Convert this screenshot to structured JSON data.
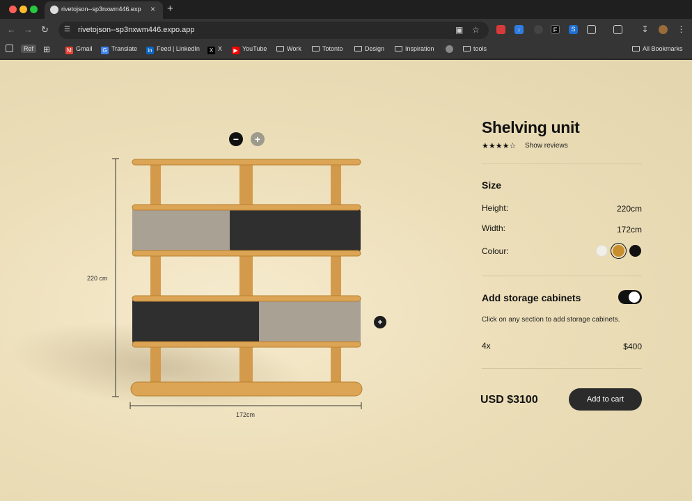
{
  "browser": {
    "tab_title": "rivetojson--sp3nxwm446.exp",
    "tab_close": "×",
    "new_tab": "+",
    "url": "rivetojson--sp3nxwm446.expo.app",
    "icons": [
      "back-icon",
      "forward-icon",
      "reload-icon",
      "site-info-icon",
      "translate-icon",
      "star-icon",
      "extensions-icon",
      "download-icon",
      "profile-icon",
      "menu-icon"
    ]
  },
  "bookmarks": [
    {
      "label": "Ref",
      "kind": "badge"
    },
    {
      "label": "Gmail",
      "kind": "gmail"
    },
    {
      "label": "Translate",
      "kind": "translate"
    },
    {
      "label": "Feed | LinkedIn",
      "kind": "linkedin"
    },
    {
      "label": "X",
      "kind": "x"
    },
    {
      "label": "YouTube",
      "kind": "youtube"
    },
    {
      "label": "Work",
      "kind": "folder"
    },
    {
      "label": "Totonto",
      "kind": "folder"
    },
    {
      "label": "Design",
      "kind": "folder"
    },
    {
      "label": "Inspiration",
      "kind": "folder"
    },
    {
      "label": "",
      "kind": "globe"
    },
    {
      "label": "tools",
      "kind": "folder"
    },
    {
      "label": "All Bookmarks",
      "kind": "folder"
    }
  ],
  "product": {
    "name": "Shelving unit",
    "rating": 4,
    "rating_max": 5,
    "reviews_link": "Show reviews",
    "size_heading": "Size",
    "height_label": "Height:",
    "height_value": "220cm",
    "width_label": "Width:",
    "width_value": "172cm",
    "colour_label": "Colour:",
    "colours": [
      "#f2efe7",
      "#c98f2e",
      "#111111"
    ],
    "selected_colour": 1,
    "storage_heading": "Add storage cabinets",
    "storage_enabled": true,
    "storage_hint": "Click on any section to add storage cabinets.",
    "cabinet_qty": "4x",
    "cabinet_price": "$400",
    "total_price": "USD $3100",
    "add_to_cart": "Add to cart"
  },
  "viewer": {
    "zoom_out": "−",
    "zoom_in": "+",
    "height_dim": "220 cm",
    "width_dim": "172cm",
    "add_cabinet": "+"
  },
  "colors": {
    "wood": "#d8a04f",
    "wood_dark": "#b97f2f",
    "fabric_dark": "#2e2e2e",
    "fabric_light": "#a9a296",
    "page_bg": "#e9dcb6"
  }
}
